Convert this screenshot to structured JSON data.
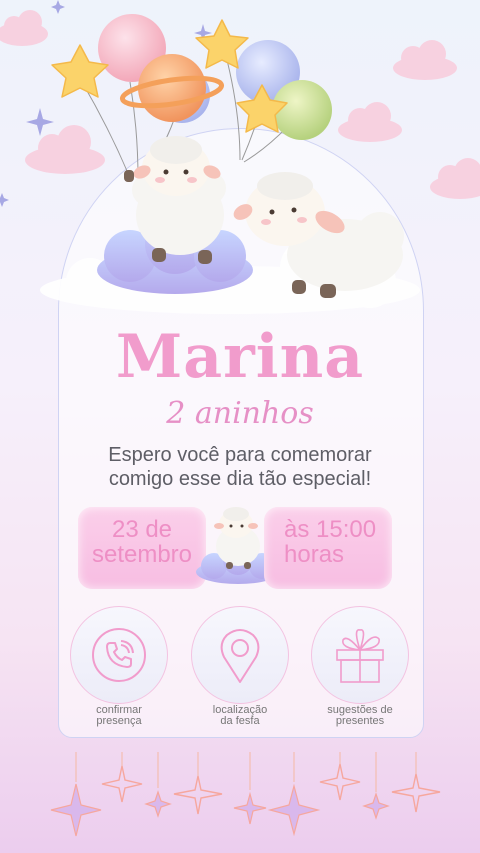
{
  "invite": {
    "name": "Marina",
    "age": "2 aninhos",
    "message_line1": "Espero você para comemorar",
    "message_line2": "comigo esse dia tão especial!"
  },
  "event": {
    "date_line1": "23 de",
    "date_line2": "setembro",
    "time_line1": "às 15:00",
    "time_line2": "horas"
  },
  "actions": [
    {
      "label_line1": "confirmar",
      "label_line2": "presença",
      "icon": "phone-icon"
    },
    {
      "label_line1": "localização",
      "label_line2": "da fesfa",
      "icon": "map-pin-icon"
    },
    {
      "label_line1": "sugestões de",
      "label_line2": "presentes",
      "icon": "gift-icon"
    }
  ],
  "colors": {
    "accent_pink": "#f19ccc",
    "pill_pink": "#f7bde2",
    "text_gray": "#5e5e66",
    "outline_lilac": "#cfd3f3"
  }
}
